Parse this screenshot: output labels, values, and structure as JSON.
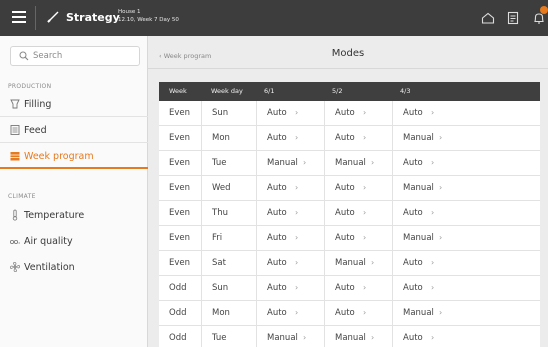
{
  "topbar": {
    "app_label": "Strategy",
    "house_name": "House 1",
    "house_info": "12.10, Week 7 Day 50",
    "icons": [
      "menu-icon",
      "strategy-icon",
      "home-icon",
      "report-icon",
      "bell-icon"
    ],
    "badge_count": "1"
  },
  "sidebar": {
    "search_placeholder": "Search",
    "sections": [
      {
        "title": "PRODUCTION",
        "items": [
          {
            "label": "Filling",
            "icon": "filling-icon"
          },
          {
            "label": "Feed",
            "icon": "feed-icon"
          },
          {
            "label": "Week program",
            "icon": "week-program-icon",
            "active": true
          }
        ]
      },
      {
        "title": "CLIMATE",
        "items": [
          {
            "label": "Temperature",
            "icon": "thermometer-icon"
          },
          {
            "label": "Air quality",
            "icon": "air-quality-icon"
          },
          {
            "label": "Ventilation",
            "icon": "fan-icon"
          }
        ]
      }
    ]
  },
  "main": {
    "breadcrumb": "Week program",
    "title": "Modes",
    "columns": [
      "Week",
      "Week day",
      "6/1",
      "5/2",
      "4/3"
    ],
    "rows": [
      {
        "week": "Even",
        "day": "Sun",
        "c1": "Auto",
        "c2": "Auto",
        "c3": "Auto"
      },
      {
        "week": "Even",
        "day": "Mon",
        "c1": "Auto",
        "c2": "Auto",
        "c3": "Manual"
      },
      {
        "week": "Even",
        "day": "Tue",
        "c1": "Manual",
        "c2": "Manual",
        "c3": "Auto"
      },
      {
        "week": "Even",
        "day": "Wed",
        "c1": "Auto",
        "c2": "Auto",
        "c3": "Manual"
      },
      {
        "week": "Even",
        "day": "Thu",
        "c1": "Auto",
        "c2": "Auto",
        "c3": "Auto"
      },
      {
        "week": "Even",
        "day": "Fri",
        "c1": "Auto",
        "c2": "Auto",
        "c3": "Manual"
      },
      {
        "week": "Even",
        "day": "Sat",
        "c1": "Auto",
        "c2": "Manual",
        "c3": "Auto"
      },
      {
        "week": "Odd",
        "day": "Sun",
        "c1": "Auto",
        "c2": "Auto",
        "c3": "Auto"
      },
      {
        "week": "Odd",
        "day": "Mon",
        "c1": "Auto",
        "c2": "Auto",
        "c3": "Manual"
      },
      {
        "week": "Odd",
        "day": "Tue",
        "c1": "Manual",
        "c2": "Manual",
        "c3": "Auto"
      }
    ]
  },
  "colors": {
    "accent": "#e57a1e",
    "topbar": "#3d3d3d",
    "table_header": "#3f3f3f"
  }
}
